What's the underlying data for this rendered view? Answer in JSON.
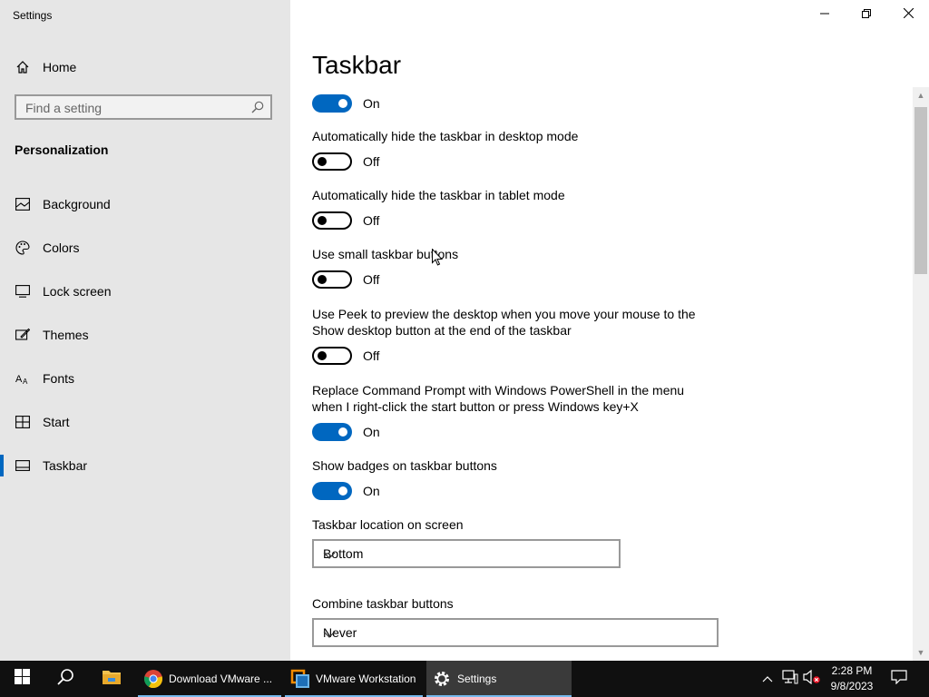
{
  "window": {
    "title": "Settings"
  },
  "sidebar": {
    "home_label": "Home",
    "search_placeholder": "Find a setting",
    "section_title": "Personalization",
    "items": [
      {
        "label": "Background",
        "icon": "picture-icon"
      },
      {
        "label": "Colors",
        "icon": "palette-icon"
      },
      {
        "label": "Lock screen",
        "icon": "lock-screen-icon"
      },
      {
        "label": "Themes",
        "icon": "themes-icon"
      },
      {
        "label": "Fonts",
        "icon": "fonts-icon"
      },
      {
        "label": "Start",
        "icon": "start-icon"
      },
      {
        "label": "Taskbar",
        "icon": "taskbar-icon",
        "active": true
      }
    ]
  },
  "main": {
    "title": "Taskbar",
    "lock_toggle_state": "On",
    "settings": [
      {
        "label": "Automatically hide the taskbar in desktop mode",
        "state": "Off"
      },
      {
        "label": "Automatically hide the taskbar in tablet mode",
        "state": "Off"
      },
      {
        "label": "Use small taskbar buttons",
        "state": "Off"
      },
      {
        "label": "Use Peek to preview the desktop when you move your mouse to the Show desktop button at the end of the taskbar",
        "state": "Off"
      },
      {
        "label": "Replace Command Prompt with Windows PowerShell in the menu when I right-click the start button or press Windows key+X",
        "state": "On"
      },
      {
        "label": "Show badges on taskbar buttons",
        "state": "On"
      }
    ],
    "location": {
      "label": "Taskbar location on screen",
      "value": "Bottom"
    },
    "combine": {
      "label": "Combine taskbar buttons",
      "value": "Never"
    }
  },
  "taskbar": {
    "apps": [
      {
        "label": "Download VMware ...",
        "icon": "chrome-icon"
      },
      {
        "label": "VMware Workstation",
        "icon": "vmware-icon"
      },
      {
        "label": "Settings",
        "icon": "gear-icon"
      }
    ],
    "time": "2:28 PM",
    "date": "9/8/2023"
  },
  "colors": {
    "accent": "#0067c0",
    "sidebar_bg": "#e6e6e6",
    "taskbar_bg": "#101010"
  }
}
